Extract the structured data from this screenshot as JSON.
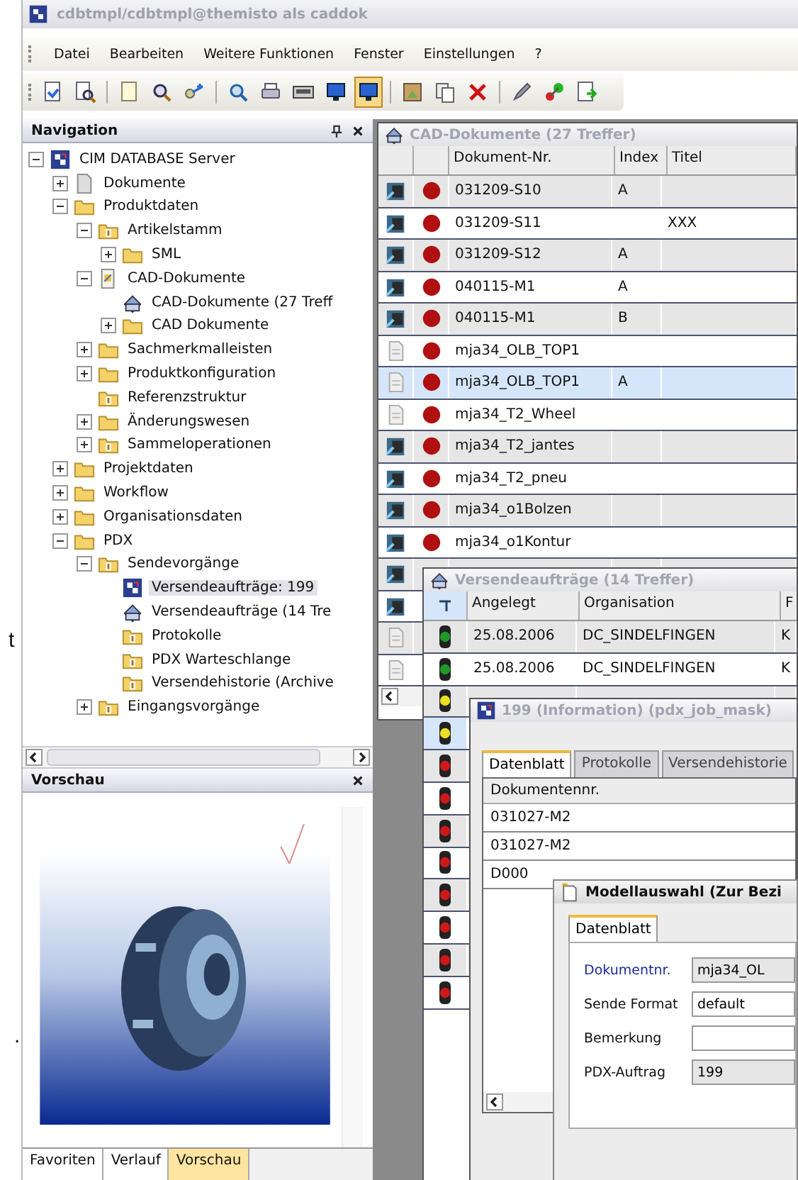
{
  "margin_marks": [
    "t",
    "."
  ],
  "window": {
    "title": "cdbtmpl/cdbtmpl@themisto als caddok"
  },
  "menu": [
    "Datei",
    "Bearbeiten",
    "Weitere Funktionen",
    "Fenster",
    "Einstellungen",
    "?"
  ],
  "toolbar": [
    {
      "kind": "button",
      "selected": false
    },
    {
      "kind": "button",
      "selected": false
    },
    {
      "kind": "separator"
    },
    {
      "kind": "button",
      "selected": false
    },
    {
      "kind": "button",
      "selected": false
    },
    {
      "kind": "button",
      "selected": false
    },
    {
      "kind": "separator"
    },
    {
      "kind": "button",
      "selected": false
    },
    {
      "kind": "button",
      "selected": false
    },
    {
      "kind": "button",
      "selected": false
    },
    {
      "kind": "button",
      "selected": false
    },
    {
      "kind": "button",
      "selected": true
    },
    {
      "kind": "separator"
    },
    {
      "kind": "button",
      "selected": false
    },
    {
      "kind": "button",
      "selected": false
    },
    {
      "kind": "button",
      "selected": false
    },
    {
      "kind": "separator"
    },
    {
      "kind": "button",
      "selected": false
    },
    {
      "kind": "button",
      "selected": false
    },
    {
      "kind": "button",
      "selected": false
    }
  ],
  "navigation": {
    "title": "Navigation",
    "tree": [
      {
        "label": "CIM DATABASE Server",
        "kind": "server",
        "expanded": true,
        "selected": false,
        "children": [
          {
            "label": "Dokumente",
            "kind": "document",
            "expanded": false,
            "selected": false
          },
          {
            "label": "Produktdaten",
            "kind": "folder",
            "expanded": true,
            "selected": false,
            "children": [
              {
                "label": "Artikelstamm",
                "kind": "info",
                "expanded": true,
                "selected": false,
                "children": [
                  {
                    "label": "SML",
                    "kind": "folder",
                    "expanded": false,
                    "selected": false
                  }
                ]
              },
              {
                "label": "CAD-Dokumente",
                "kind": "cad",
                "expanded": true,
                "selected": false,
                "children": [
                  {
                    "label": "CAD-Dokumente (27 Treff",
                    "kind": "query",
                    "selected": false
                  },
                  {
                    "label": "CAD Dokumente",
                    "kind": "folder",
                    "expanded": false,
                    "selected": false
                  }
                ]
              },
              {
                "label": "Sachmerkmalleisten",
                "kind": "folder",
                "expanded": false,
                "selected": false
              },
              {
                "label": "Produktkonfiguration",
                "kind": "folder",
                "expanded": false,
                "selected": false
              },
              {
                "label": "Referenzstruktur",
                "kind": "info",
                "selected": false
              },
              {
                "label": "Änderungswesen",
                "kind": "folder",
                "expanded": false,
                "selected": false
              },
              {
                "label": "Sammeloperationen",
                "kind": "info",
                "expanded": false,
                "selected": false
              }
            ]
          },
          {
            "label": "Projektdaten",
            "kind": "folder",
            "expanded": false,
            "selected": false
          },
          {
            "label": "Workflow",
            "kind": "folder",
            "expanded": false,
            "selected": false
          },
          {
            "label": "Organisationsdaten",
            "kind": "folder",
            "expanded": false,
            "selected": false
          },
          {
            "label": "PDX",
            "kind": "folder",
            "expanded": true,
            "selected": false,
            "children": [
              {
                "label": "Sendevorgänge",
                "kind": "info",
                "expanded": true,
                "selected": false,
                "children": [
                  {
                    "label": "Versendeaufträge: 199",
                    "kind": "server",
                    "selected": true
                  },
                  {
                    "label": "Versendeaufträge (14 Tre",
                    "kind": "query",
                    "selected": false
                  },
                  {
                    "label": "Protokolle",
                    "kind": "info",
                    "selected": false
                  },
                  {
                    "label": "PDX Warteschlange",
                    "kind": "info",
                    "selected": false
                  },
                  {
                    "label": "Versendehistorie (Archive",
                    "kind": "info",
                    "selected": false
                  }
                ]
              },
              {
                "label": "Eingangsvorgänge",
                "kind": "info",
                "expanded": false,
                "selected": false
              }
            ]
          }
        ]
      }
    ]
  },
  "preview": {
    "title": "Vorschau",
    "kind": "picture"
  },
  "bottom_tabs": [
    {
      "label": "Favoriten",
      "selected": false
    },
    {
      "label": "Verlauf",
      "selected": false
    },
    {
      "label": "Vorschau",
      "selected": true
    }
  ],
  "cad_window": {
    "title": "CAD-Dokumente (27 Treffer)",
    "columns": [
      "Dokument-Nr.",
      "Index",
      "Titel"
    ],
    "rows": [
      {
        "kind": "cad",
        "doc_nr": "031209-S10",
        "index": "A",
        "selected": false
      },
      {
        "kind": "cad",
        "doc_nr": "031209-S11",
        "titel": "XXX",
        "selected": false
      },
      {
        "kind": "cad",
        "doc_nr": "031209-S12",
        "index": "A",
        "selected": false
      },
      {
        "kind": "cad",
        "doc_nr": "040115-M1",
        "index": "A",
        "selected": false
      },
      {
        "kind": "cad",
        "doc_nr": "040115-M1",
        "index": "B",
        "selected": false
      },
      {
        "kind": "document",
        "doc_nr": "mja34_OLB_TOP1",
        "selected": false
      },
      {
        "kind": "document",
        "doc_nr": "mja34_OLB_TOP1",
        "index": "A",
        "selected": true
      },
      {
        "kind": "document",
        "doc_nr": "mja34_T2_Wheel",
        "selected": false
      },
      {
        "kind": "cad",
        "doc_nr": "mja34_T2_jantes",
        "selected": false
      },
      {
        "kind": "cad",
        "doc_nr": "mja34_T2_pneu",
        "selected": false
      },
      {
        "kind": "cad",
        "doc_nr": "mja34_o1Bolzen",
        "selected": false
      },
      {
        "kind": "cad",
        "doc_nr": "mja34_o1Kontur",
        "selected": false
      },
      {
        "kind": "cad",
        "status_dot": false,
        "selected": false
      },
      {
        "kind": "cad",
        "status_dot": false,
        "selected": false
      },
      {
        "kind": "document",
        "status_dot": false,
        "selected": false
      },
      {
        "kind": "document",
        "status_dot": false,
        "selected": false
      }
    ]
  },
  "orders_window": {
    "title": "Versendeaufträge (14 Treffer)",
    "columns": [
      "Angelegt",
      "Organisation",
      "F"
    ],
    "rows": [
      {
        "color": "#1f9a2a",
        "created": "25.08.2006",
        "organisation": "DC_SINDELFINGEN",
        "column_3": "K",
        "selected": false
      },
      {
        "color": "#1f9a2a",
        "created": "25.08.2006",
        "organisation": "DC_SINDELFINGEN",
        "column_3": "K",
        "selected": false
      },
      {
        "color": "#e8e020",
        "selected": false
      },
      {
        "color": "#e8e020",
        "selected": true
      },
      {
        "color": "#d01818",
        "selected": false
      },
      {
        "color": "#d01818",
        "selected": false
      },
      {
        "color": "#d01818",
        "selected": false
      },
      {
        "color": "#d01818",
        "selected": false
      },
      {
        "color": "#d01818",
        "selected": false
      },
      {
        "color": "#d01818",
        "selected": false
      },
      {
        "color": "#d01818",
        "selected": false
      },
      {
        "color": "#d01818",
        "selected": false
      }
    ]
  },
  "info_window": {
    "title": "199 (Information) (pdx_job_mask)",
    "tabs": [
      {
        "label": "Datenblatt",
        "selected": true
      },
      {
        "label": "Protokolle",
        "selected": false
      },
      {
        "label": "Versendehistorie",
        "selected": false
      }
    ],
    "table": {
      "columns": [
        "Dokumentennr."
      ],
      "rows": [
        "031027-M2",
        "031027-M2",
        "D000"
      ]
    }
  },
  "model_window": {
    "title": "Modellauswahl (Zur Bezi",
    "tabs": [
      {
        "label": "Datenblatt",
        "selected": true
      }
    ],
    "fields": [
      {
        "label": "Dokumentnr.",
        "value": "mja34_OL",
        "mandatory": true,
        "readonly": true
      },
      {
        "label": "Sende Format",
        "value": "default",
        "mandatory": false,
        "readonly": false
      },
      {
        "label": "Bemerkung",
        "mandatory": false,
        "readonly": false
      },
      {
        "label": "PDX-Auftrag",
        "value": "199",
        "mandatory": false,
        "readonly": true
      }
    ]
  }
}
